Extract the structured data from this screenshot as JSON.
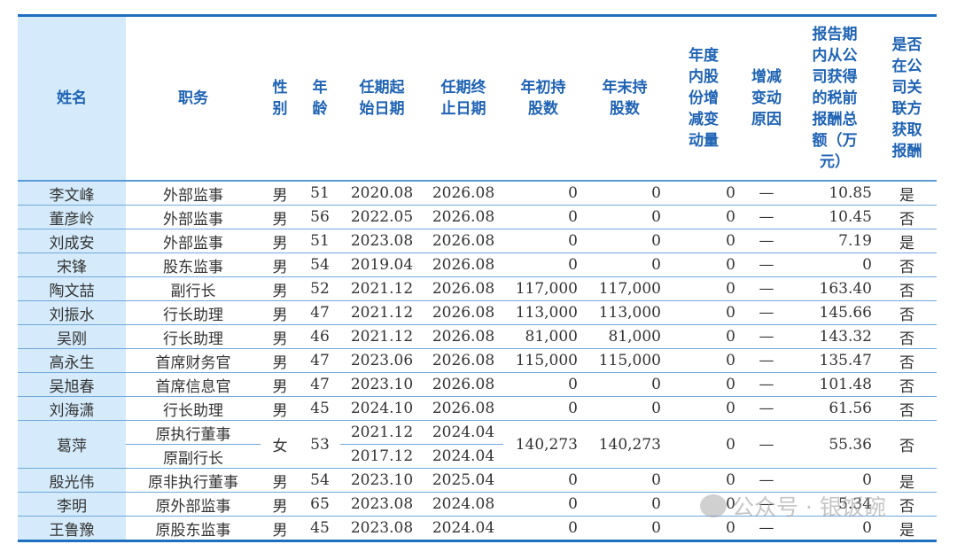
{
  "headers": [
    "姓名",
    "职务",
    "性\n别",
    "年\n龄",
    "任期起\n始日期",
    "任期终\n止日期",
    "年初持\n股数",
    "年末持\n股数",
    "年度\n内股\n份增\n减变\n动量",
    "增减\n变动\n原因",
    "报告期\n内从公\n司获得\n的税前\n报酬总\n额（万\n元）",
    "是否\n在公\n司关\n联方\n获取\n报酬"
  ],
  "rows": [
    [
      "李文峰",
      "外部监事",
      "男",
      "51",
      "2020.08",
      "2026.08",
      "0",
      "0",
      "0",
      "—",
      "10.85",
      "是"
    ],
    [
      "董彦岭",
      "外部监事",
      "男",
      "56",
      "2022.05",
      "2026.08",
      "0",
      "0",
      "0",
      "—",
      "10.45",
      "否"
    ],
    [
      "刘成安",
      "外部监事",
      "男",
      "51",
      "2023.08",
      "2026.08",
      "0",
      "0",
      "0",
      "—",
      "7.19",
      "是"
    ],
    [
      "宋锋",
      "股东监事",
      "男",
      "54",
      "2019.04",
      "2026.08",
      "0",
      "0",
      "0",
      "—",
      "0",
      "否"
    ],
    [
      "陶文喆",
      "副行长",
      "男",
      "52",
      "2021.12",
      "2026.08",
      "117,000",
      "117,000",
      "0",
      "—",
      "163.40",
      "否"
    ],
    [
      "刘振水",
      "行长助理",
      "男",
      "47",
      "2021.12",
      "2026.08",
      "113,000",
      "113,000",
      "0",
      "—",
      "145.66",
      "否"
    ],
    [
      "吴刚",
      "行长助理",
      "男",
      "46",
      "2021.12",
      "2026.08",
      "81,000",
      "81,000",
      "0",
      "—",
      "143.32",
      "否"
    ],
    [
      "高永生",
      "首席财务官",
      "男",
      "47",
      "2023.06",
      "2026.08",
      "115,000",
      "115,000",
      "0",
      "—",
      "135.47",
      "否"
    ],
    [
      "吴旭春",
      "首席信息官",
      "男",
      "47",
      "2023.10",
      "2026.08",
      "0",
      "0",
      "0",
      "—",
      "101.48",
      "否"
    ],
    [
      "刘海潇",
      "行长助理",
      "男",
      "45",
      "2024.10",
      "2026.08",
      "0",
      "0",
      "0",
      "—",
      "61.56",
      "否"
    ]
  ],
  "split_row": {
    "name": "葛萍",
    "gender": "女",
    "age": "53",
    "terms": [
      {
        "role": "原执行董事",
        "start": "2021.12",
        "end": "2024.04"
      },
      {
        "role": "原副行长",
        "start": "2017.12",
        "end": "2024.04"
      }
    ],
    "shares_begin": "140,273",
    "shares_end": "140,273",
    "change": "0",
    "reason": "—",
    "pay": "55.36",
    "related": "否"
  },
  "rows_after": [
    [
      "殷光伟",
      "原非执行董事",
      "男",
      "54",
      "2023.10",
      "2025.04",
      "0",
      "0",
      "0",
      "—",
      "0",
      "是"
    ],
    [
      "李明",
      "原外部监事",
      "男",
      "65",
      "2023.08",
      "2024.08",
      "0",
      "0",
      "0",
      "—",
      "5.34",
      "否"
    ],
    [
      "王鲁豫",
      "原股东监事",
      "男",
      "45",
      "2023.08",
      "2024.04",
      "0",
      "0",
      "0",
      "—",
      "0",
      "是"
    ]
  ],
  "watermark": "公众号 · 银饭碗"
}
